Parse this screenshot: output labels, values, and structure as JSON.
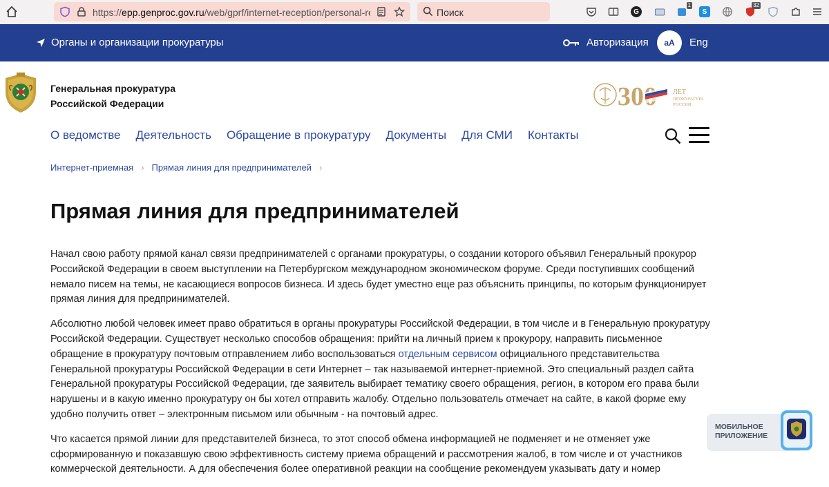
{
  "browser": {
    "url_domain": "epp.genproc.gov.ru",
    "url_scheme": "https://",
    "url_path": "/web/gprf/internet-reception/personal-recep",
    "search_placeholder": "Поиск",
    "badges": {
      "ext1": "1",
      "ext2": "32"
    }
  },
  "topbar": {
    "orgs_label": "Органы и организации прокуратуры",
    "auth_label": "Авторизация",
    "font_toggle": "аА",
    "lang_label": "Eng"
  },
  "header": {
    "org_name_line1": "Генеральная прокуратура",
    "org_name_line2": "Российской Федерации",
    "anniversary_number": "300",
    "anniversary_text1": "ЛЕТ",
    "anniversary_text2": "ПРОКУРАТУРА",
    "anniversary_text3": "РОССИИ"
  },
  "nav": {
    "items": [
      "О ведомстве",
      "Деятельность",
      "Обращение в прокуратуру",
      "Документы",
      "Для СМИ",
      "Контакты"
    ]
  },
  "breadcrumb": {
    "items": [
      "Интернет-приемная",
      "Прямая линия для предпринимателей"
    ]
  },
  "page": {
    "title": "Прямая линия для предпринимателей",
    "p1": "Начал свою работу прямой канал связи предпринимателей с органами прокуратуры, о создании которого объявил Генеральный прокурор Российской Федерации в своем выступлении на Петербургском международном экономическом форуме. Среди поступивших сообщений немало писем на темы, не касающиеся вопросов бизнеса. И здесь будет уместно еще раз объяснить принципы, по которым функционирует прямая линия для предпринимателей.",
    "p2_before": "Абсолютно любой человек имеет право обратиться в органы прокуратуры Российской Федерации, в том числе и в Генеральную прокуратуру Российской Федерации. Существует несколько способов обращения: прийти на личный прием к прокурору, направить письменное обращение в прокуратуру почтовым отправлением либо воспользоваться ",
    "p2_link": "отдельным сервисом",
    "p2_after": " официального представительства Генеральной прокуратуры Российской Федерации в сети Интернет – так называемой интернет-приемной. Это специальный раздел сайта Генеральной прокуратуры Российской Федерации, где заявитель выбирает тематику своего обращения, регион, в котором его права были нарушены и в какую именно прокуратуру он бы хотел отправить жалобу. Отдельно пользователь отмечает на сайте, в какой форме ему удобно получить ответ – электронным письмом или обычным - на почтовый адрес.",
    "p3": "Что касается прямой линии для представителей бизнеса, то этот способ обмена информацией не подменяет и не отменяет уже сформированную и показавшую свою эффективность систему приема обращений и рассмотрения жалоб, в том числе и от участников коммерческой деятельности. А для обеспечения более оперативной реакции на сообщение рекомендуем указывать дату и номер"
  },
  "mobile_app": {
    "label": "МОБИЛЬНОЕ ПРИЛОЖЕНИЕ"
  },
  "colors": {
    "brand_blue": "#233f8f",
    "link_blue": "#2c4aa1",
    "gold": "#c9a46a"
  }
}
